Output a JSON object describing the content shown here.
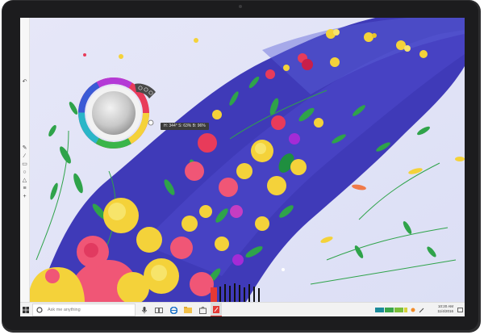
{
  "taskbar": {
    "search_placeholder": "Ask me anything",
    "clock_time": "10:20 AM",
    "clock_date": "11/4/2016",
    "apps": [
      "task-view",
      "edge",
      "file-explorer",
      "store",
      "sketchable"
    ],
    "tray_swatches": [
      "#1b8b9a",
      "#3aa64a",
      "#7bbf3a",
      "#d6d23a",
      "#f28c28"
    ]
  },
  "color_picker": {
    "readout": "H: 344° S: 63% B: 96%"
  },
  "colors": {
    "canvas_blue": "#3f3ab8",
    "wheel_center": "#d2d2d2",
    "taskbar_bg": "#f2f2f2",
    "accent_red": "#e53935"
  },
  "left_toolbar": {
    "icons": [
      "pen-icon",
      "brush-icon",
      "eraser-icon",
      "lasso-icon",
      "shape-icon",
      "layers-icon",
      "zoom-icon"
    ]
  }
}
